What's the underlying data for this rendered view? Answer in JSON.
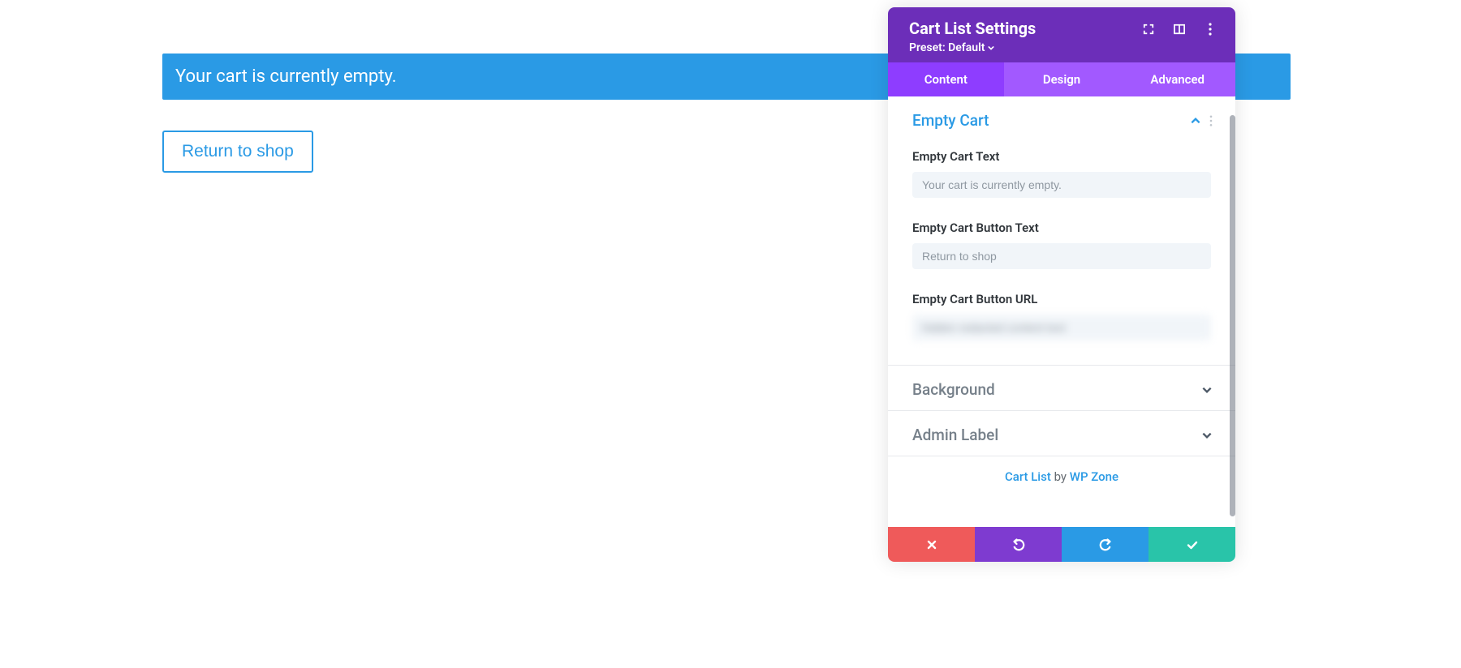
{
  "preview": {
    "notice_text": "Your cart is currently empty.",
    "return_button_text": "Return to shop"
  },
  "panel": {
    "title": "Cart List Settings",
    "preset_label": "Preset: Default",
    "tabs": {
      "content": "Content",
      "design": "Design",
      "advanced": "Advanced",
      "active": "content"
    },
    "sections": {
      "empty_cart": {
        "title": "Empty Cart",
        "expanded": true,
        "fields": {
          "text": {
            "label": "Empty Cart Text",
            "placeholder": "Your cart is currently empty."
          },
          "button_text": {
            "label": "Empty Cart Button Text",
            "placeholder": "Return to shop"
          },
          "button_url": {
            "label": "Empty Cart Button URL",
            "value": ""
          }
        }
      },
      "background": {
        "title": "Background",
        "expanded": false
      },
      "admin_label": {
        "title": "Admin Label",
        "expanded": false
      }
    },
    "credit": {
      "prefix": "Cart List",
      "mid": " by ",
      "suffix": "WP Zone"
    },
    "footer_icons": {
      "cancel": "close-icon",
      "undo": "undo-icon",
      "redo": "redo-icon",
      "save": "check-icon"
    }
  }
}
